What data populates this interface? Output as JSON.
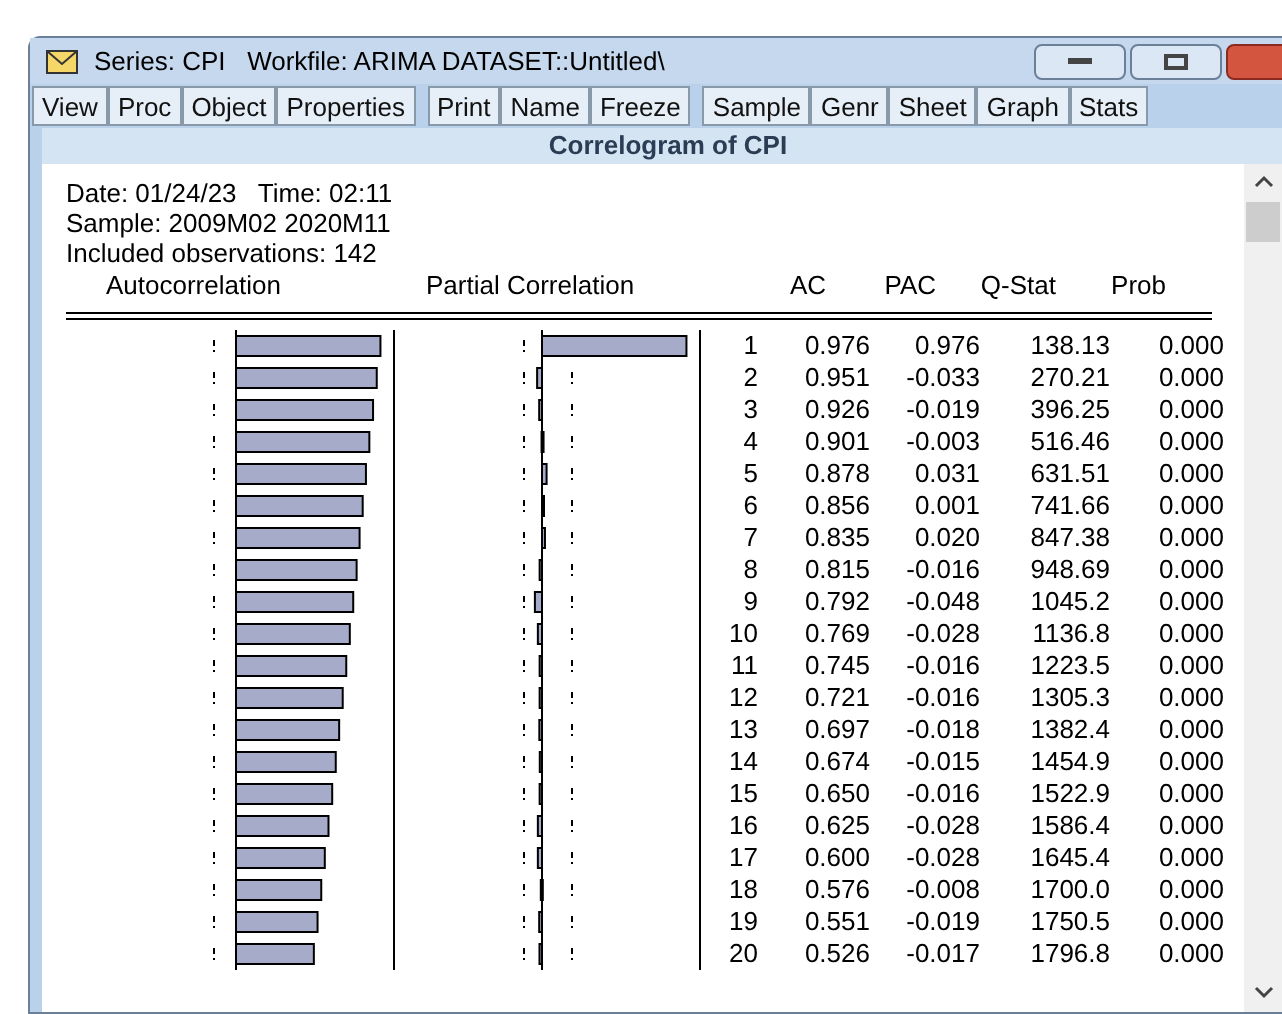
{
  "window": {
    "title": "Series: CPI   Workfile: ARIMA DATASET::Untitled\\"
  },
  "toolbar": [
    [
      "View",
      "Proc",
      "Object",
      "Properties"
    ],
    [
      "Print",
      "Name",
      "Freeze"
    ],
    [
      "Sample",
      "Genr",
      "Sheet",
      "Graph",
      "Stats"
    ]
  ],
  "view_title": "Correlogram of CPI",
  "info": [
    "Date: 01/24/23   Time: 02:11",
    "Sample: 2009M02 2020M11",
    "Included observations: 142"
  ],
  "columns": [
    "Autocorrelation",
    "Partial Correlation",
    "AC",
    "PAC",
    "Q-Stat",
    "Prob"
  ],
  "rows": [
    {
      "lag": "1",
      "ac": "0.976",
      "pac": "0.976",
      "q": "138.13",
      "prob": "0.000"
    },
    {
      "lag": "2",
      "ac": "0.951",
      "pac": "-0.033",
      "q": "270.21",
      "prob": "0.000"
    },
    {
      "lag": "3",
      "ac": "0.926",
      "pac": "-0.019",
      "q": "396.25",
      "prob": "0.000"
    },
    {
      "lag": "4",
      "ac": "0.901",
      "pac": "-0.003",
      "q": "516.46",
      "prob": "0.000"
    },
    {
      "lag": "5",
      "ac": "0.878",
      "pac": "0.031",
      "q": "631.51",
      "prob": "0.000"
    },
    {
      "lag": "6",
      "ac": "0.856",
      "pac": "0.001",
      "q": "741.66",
      "prob": "0.000"
    },
    {
      "lag": "7",
      "ac": "0.835",
      "pac": "0.020",
      "q": "847.38",
      "prob": "0.000"
    },
    {
      "lag": "8",
      "ac": "0.815",
      "pac": "-0.016",
      "q": "948.69",
      "prob": "0.000"
    },
    {
      "lag": "9",
      "ac": "0.792",
      "pac": "-0.048",
      "q": "1045.2",
      "prob": "0.000"
    },
    {
      "lag": "10",
      "ac": "0.769",
      "pac": "-0.028",
      "q": "1136.8",
      "prob": "0.000"
    },
    {
      "lag": "11",
      "ac": "0.745",
      "pac": "-0.016",
      "q": "1223.5",
      "prob": "0.000"
    },
    {
      "lag": "12",
      "ac": "0.721",
      "pac": "-0.016",
      "q": "1305.3",
      "prob": "0.000"
    },
    {
      "lag": "13",
      "ac": "0.697",
      "pac": "-0.018",
      "q": "1382.4",
      "prob": "0.000"
    },
    {
      "lag": "14",
      "ac": "0.674",
      "pac": "-0.015",
      "q": "1454.9",
      "prob": "0.000"
    },
    {
      "lag": "15",
      "ac": "0.650",
      "pac": "-0.016",
      "q": "1522.9",
      "prob": "0.000"
    },
    {
      "lag": "16",
      "ac": "0.625",
      "pac": "-0.028",
      "q": "1586.4",
      "prob": "0.000"
    },
    {
      "lag": "17",
      "ac": "0.600",
      "pac": "-0.028",
      "q": "1645.4",
      "prob": "0.000"
    },
    {
      "lag": "18",
      "ac": "0.576",
      "pac": "-0.008",
      "q": "1700.0",
      "prob": "0.000"
    },
    {
      "lag": "19",
      "ac": "0.551",
      "pac": "-0.019",
      "q": "1750.5",
      "prob": "0.000"
    },
    {
      "lag": "20",
      "ac": "0.526",
      "pac": "-0.017",
      "q": "1796.8",
      "prob": "0.000"
    }
  ]
}
